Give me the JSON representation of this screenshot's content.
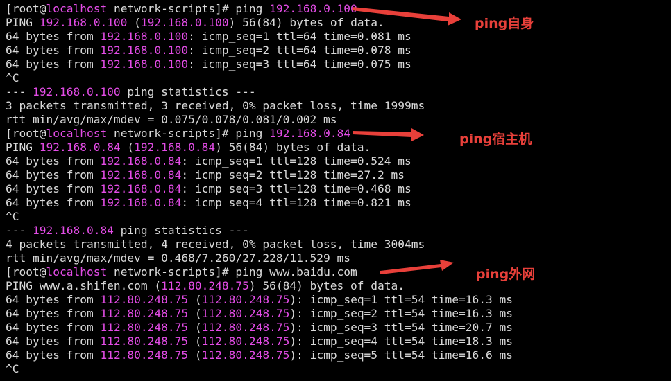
{
  "theme": {
    "background": "#000000",
    "text_color": "#d9d9d9",
    "highlight_color": "#e34ce6",
    "annotation_color": "#e8403a"
  },
  "terminal": {
    "lines": [
      [
        {
          "t": "[root@",
          "c": "plain"
        },
        {
          "t": "localhost",
          "c": "host"
        },
        {
          "t": " network-scripts]# ping ",
          "c": "plain"
        },
        {
          "t": "192.168.0.100",
          "c": "ip"
        }
      ],
      [
        {
          "t": "PING ",
          "c": "plain"
        },
        {
          "t": "192.168.0.100",
          "c": "ip"
        },
        {
          "t": " (",
          "c": "plain"
        },
        {
          "t": "192.168.0.100",
          "c": "ip"
        },
        {
          "t": ") 56(84) bytes of data.",
          "c": "plain"
        }
      ],
      [
        {
          "t": "64 bytes from ",
          "c": "plain"
        },
        {
          "t": "192.168.0.100",
          "c": "ip"
        },
        {
          "t": ": icmp_seq=1 ttl=64 time=0.081 ms",
          "c": "plain"
        }
      ],
      [
        {
          "t": "64 bytes from ",
          "c": "plain"
        },
        {
          "t": "192.168.0.100",
          "c": "ip"
        },
        {
          "t": ": icmp_seq=2 ttl=64 time=0.078 ms",
          "c": "plain"
        }
      ],
      [
        {
          "t": "64 bytes from ",
          "c": "plain"
        },
        {
          "t": "192.168.0.100",
          "c": "ip"
        },
        {
          "t": ": icmp_seq=3 ttl=64 time=0.075 ms",
          "c": "plain"
        }
      ],
      [
        {
          "t": "^C",
          "c": "plain"
        }
      ],
      [
        {
          "t": "--- ",
          "c": "plain"
        },
        {
          "t": "192.168.0.100",
          "c": "ip"
        },
        {
          "t": " ping statistics ---",
          "c": "plain"
        }
      ],
      [
        {
          "t": "3 packets transmitted, 3 received, 0% packet loss, time 1999ms",
          "c": "plain"
        }
      ],
      [
        {
          "t": "rtt min/avg/max/mdev = 0.075/0.078/0.081/0.002 ms",
          "c": "plain"
        }
      ],
      [
        {
          "t": "[root@",
          "c": "plain"
        },
        {
          "t": "localhost",
          "c": "host"
        },
        {
          "t": " network-scripts]# ping ",
          "c": "plain"
        },
        {
          "t": "192.168.0.84",
          "c": "ip"
        }
      ],
      [
        {
          "t": "PING ",
          "c": "plain"
        },
        {
          "t": "192.168.0.84",
          "c": "ip"
        },
        {
          "t": " (",
          "c": "plain"
        },
        {
          "t": "192.168.0.84",
          "c": "ip"
        },
        {
          "t": ") 56(84) bytes of data.",
          "c": "plain"
        }
      ],
      [
        {
          "t": "64 bytes from ",
          "c": "plain"
        },
        {
          "t": "192.168.0.84",
          "c": "ip"
        },
        {
          "t": ": icmp_seq=1 ttl=128 time=0.524 ms",
          "c": "plain"
        }
      ],
      [
        {
          "t": "64 bytes from ",
          "c": "plain"
        },
        {
          "t": "192.168.0.84",
          "c": "ip"
        },
        {
          "t": ": icmp_seq=2 ttl=128 time=27.2 ms",
          "c": "plain"
        }
      ],
      [
        {
          "t": "64 bytes from ",
          "c": "plain"
        },
        {
          "t": "192.168.0.84",
          "c": "ip"
        },
        {
          "t": ": icmp_seq=3 ttl=128 time=0.468 ms",
          "c": "plain"
        }
      ],
      [
        {
          "t": "64 bytes from ",
          "c": "plain"
        },
        {
          "t": "192.168.0.84",
          "c": "ip"
        },
        {
          "t": ": icmp_seq=4 ttl=128 time=0.821 ms",
          "c": "plain"
        }
      ],
      [
        {
          "t": "^C",
          "c": "plain"
        }
      ],
      [
        {
          "t": "--- ",
          "c": "plain"
        },
        {
          "t": "192.168.0.84",
          "c": "ip"
        },
        {
          "t": " ping statistics ---",
          "c": "plain"
        }
      ],
      [
        {
          "t": "4 packets transmitted, 4 received, 0% packet loss, time 3004ms",
          "c": "plain"
        }
      ],
      [
        {
          "t": "rtt min/avg/max/mdev = 0.468/7.260/27.228/11.529 ms",
          "c": "plain"
        }
      ],
      [
        {
          "t": "[root@",
          "c": "plain"
        },
        {
          "t": "localhost",
          "c": "host"
        },
        {
          "t": " network-scripts]# ping www.baidu.com",
          "c": "plain"
        }
      ],
      [
        {
          "t": "PING www.a.shifen.com (",
          "c": "plain"
        },
        {
          "t": "112.80.248.75",
          "c": "ip"
        },
        {
          "t": ") 56(84) bytes of data.",
          "c": "plain"
        }
      ],
      [
        {
          "t": "64 bytes from ",
          "c": "plain"
        },
        {
          "t": "112.80.248.75",
          "c": "ip"
        },
        {
          "t": " (",
          "c": "plain"
        },
        {
          "t": "112.80.248.75",
          "c": "ip"
        },
        {
          "t": "): icmp_seq=1 ttl=54 time=16.3 ms",
          "c": "plain"
        }
      ],
      [
        {
          "t": "64 bytes from ",
          "c": "plain"
        },
        {
          "t": "112.80.248.75",
          "c": "ip"
        },
        {
          "t": " (",
          "c": "plain"
        },
        {
          "t": "112.80.248.75",
          "c": "ip"
        },
        {
          "t": "): icmp_seq=2 ttl=54 time=16.3 ms",
          "c": "plain"
        }
      ],
      [
        {
          "t": "64 bytes from ",
          "c": "plain"
        },
        {
          "t": "112.80.248.75",
          "c": "ip"
        },
        {
          "t": " (",
          "c": "plain"
        },
        {
          "t": "112.80.248.75",
          "c": "ip"
        },
        {
          "t": "): icmp_seq=3 ttl=54 time=20.7 ms",
          "c": "plain"
        }
      ],
      [
        {
          "t": "64 bytes from ",
          "c": "plain"
        },
        {
          "t": "112.80.248.75",
          "c": "ip"
        },
        {
          "t": " (",
          "c": "plain"
        },
        {
          "t": "112.80.248.75",
          "c": "ip"
        },
        {
          "t": "): icmp_seq=4 ttl=54 time=18.3 ms",
          "c": "plain"
        }
      ],
      [
        {
          "t": "64 bytes from ",
          "c": "plain"
        },
        {
          "t": "112.80.248.75",
          "c": "ip"
        },
        {
          "t": " (",
          "c": "plain"
        },
        {
          "t": "112.80.248.75",
          "c": "ip"
        },
        {
          "t": "): icmp_seq=5 ttl=54 time=16.6 ms",
          "c": "plain"
        }
      ],
      [
        {
          "t": "^C",
          "c": "plain"
        }
      ]
    ]
  },
  "annotations": {
    "self": "ping自身",
    "host": "ping宿主机",
    "external": "ping外网"
  }
}
